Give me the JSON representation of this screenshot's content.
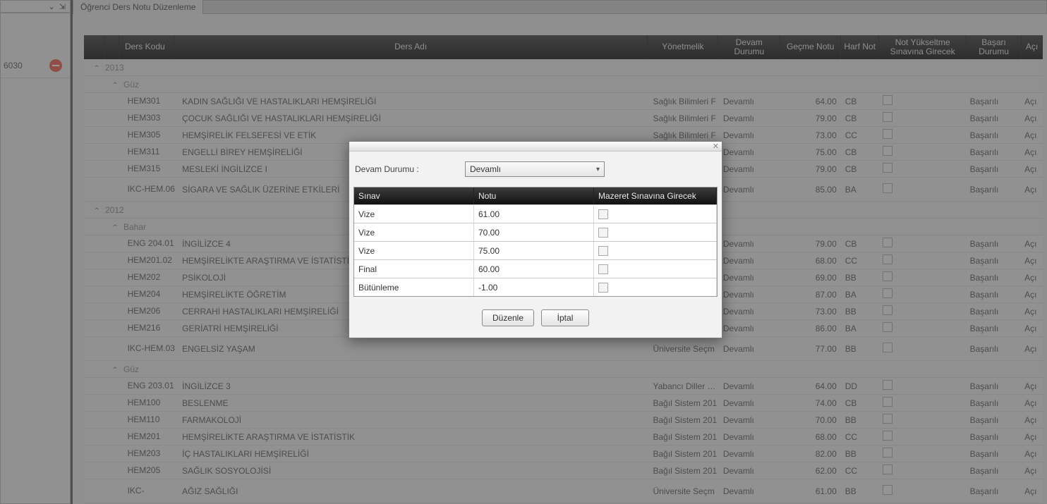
{
  "leftPanel": {
    "code": "6030"
  },
  "tab": {
    "title": "Öğrenci Ders Notu Düzenleme"
  },
  "gridHeader": {
    "dersKodu": "Ders Kodu",
    "dersAdi": "Ders Adı",
    "yonetmelik": "Yönetmelik",
    "devamDurumu": "Devam Durumu",
    "gecmeNotu": "Geçme Notu",
    "harfNot": "Harf Not",
    "notYukseltme": "Not Yükseltme Sınavına Girecek",
    "basariDurumu": "Başarı Durumu",
    "aciklama": "Açı"
  },
  "groups": [
    {
      "year": "2013",
      "terms": [
        {
          "name": "Güz",
          "rows": [
            {
              "code": "HEM301",
              "name": "KADIN SAĞLIĞI VE HASTALIKLARI HEMŞİRELİĞİ",
              "yon": "Sağlık Bilimleri F",
              "dev": "Devamlı",
              "gec": "64.00",
              "harf": "CB",
              "bas": "Başarılı",
              "ac": "Açı"
            },
            {
              "code": "HEM303",
              "name": "ÇOCUK SAĞLIĞI VE HASTALIKLARI HEMŞİRELİĞİ",
              "yon": "Sağlık Bilimleri F",
              "dev": "Devamlı",
              "gec": "79.00",
              "harf": "CB",
              "bas": "Başarılı",
              "ac": "Açı"
            },
            {
              "code": "HEM305",
              "name": "HEMŞİRELİK FELSEFESİ VE ETİK",
              "yon": "Sağlık Bilimleri F",
              "dev": "Devamlı",
              "gec": "73.00",
              "harf": "CC",
              "bas": "Başarılı",
              "ac": "Açı"
            },
            {
              "code": "HEM311",
              "name": "ENGELLİ BİREY HEMŞİRELİĞİ",
              "yon": "",
              "dev": "Devamlı",
              "gec": "75.00",
              "harf": "CB",
              "bas": "Başarılı",
              "ac": "Açı"
            },
            {
              "code": "HEM315",
              "name": "MESLEKİ İNGİLİZCE I",
              "yon": "",
              "dev": "Devamlı",
              "gec": "79.00",
              "harf": "CB",
              "bas": "Başarılı",
              "ac": "Açı"
            },
            {
              "code": "IKC-HEM.06",
              "name": "SİGARA VE SAĞLIK ÜZERİNE ETKİLERİ",
              "yon": "",
              "dev": "Devamlı",
              "gec": "85.00",
              "harf": "BA",
              "bas": "Başarılı",
              "ac": "Açı",
              "tall": true
            }
          ]
        }
      ]
    },
    {
      "year": "2012",
      "terms": [
        {
          "name": "Bahar",
          "rows": [
            {
              "code": "ENG 204.01",
              "name": "İNGİLİZCE 4",
              "yon": "",
              "dev": "Devamlı",
              "gec": "79.00",
              "harf": "CB",
              "bas": "Başarılı",
              "ac": "Açı"
            },
            {
              "code": "HEM201.02",
              "name": "HEMŞİRELİKTE ARAŞTIRMA VE İSTATİSTİK",
              "yon": "",
              "dev": "Devamlı",
              "gec": "68.00",
              "harf": "CC",
              "bas": "Başarılı",
              "ac": "Açı"
            },
            {
              "code": "HEM202",
              "name": "PSİKOLOJİ",
              "yon": "",
              "dev": "Devamlı",
              "gec": "69.00",
              "harf": "BB",
              "bas": "Başarılı",
              "ac": "Açı"
            },
            {
              "code": "HEM204",
              "name": "HEMŞİRELİKTE ÖĞRETİM",
              "yon": "",
              "dev": "Devamlı",
              "gec": "87.00",
              "harf": "BA",
              "bas": "Başarılı",
              "ac": "Açı"
            },
            {
              "code": "HEM206",
              "name": "CERRAHİ HASTALIKLARI HEMŞİRELİĞİ",
              "yon": "",
              "dev": "Devamlı",
              "gec": "73.00",
              "harf": "BB",
              "bas": "Başarılı",
              "ac": "Açı"
            },
            {
              "code": "HEM216",
              "name": "GERİATRİ HEMŞİRELİĞİ",
              "yon": "",
              "dev": "Devamlı",
              "gec": "86.00",
              "harf": "BA",
              "bas": "Başarılı",
              "ac": "Açı"
            },
            {
              "code": "IKC-HEM.03",
              "name": "ENGELSİZ YAŞAM",
              "yon": "Üniversite Seçm",
              "dev": "Devamlı",
              "gec": "77.00",
              "harf": "BB",
              "bas": "Başarılı",
              "ac": "Açı",
              "tall": true
            }
          ]
        },
        {
          "name": "Güz",
          "rows": [
            {
              "code": "ENG 203.01",
              "name": "İNGİLİZCE 3",
              "yon": "Yabancı Diller Yü",
              "dev": "Devamlı",
              "gec": "64.00",
              "harf": "DD",
              "bas": "Başarılı",
              "ac": "Açı"
            },
            {
              "code": "HEM100",
              "name": "BESLENME",
              "yon": "Bağıl Sistem 201",
              "dev": "Devamlı",
              "gec": "74.00",
              "harf": "CB",
              "bas": "Başarılı",
              "ac": "Açı"
            },
            {
              "code": "HEM110",
              "name": "FARMAKOLOJİ",
              "yon": "Bağıl Sistem 201",
              "dev": "Devamlı",
              "gec": "70.00",
              "harf": "BB",
              "bas": "Başarılı",
              "ac": "Açı"
            },
            {
              "code": "HEM201",
              "name": "HEMŞİRELİKTE ARAŞTIRMA VE İSTATİSTİK",
              "yon": "Bağıl Sistem 201",
              "dev": "Devamlı",
              "gec": "68.00",
              "harf": "CC",
              "bas": "Başarılı",
              "ac": "Açı"
            },
            {
              "code": "HEM203",
              "name": "İÇ HASTALIKLARI HEMŞİRELİĞİ",
              "yon": "Bağıl Sistem 201",
              "dev": "Devamlı",
              "gec": "82.00",
              "harf": "BB",
              "bas": "Başarılı",
              "ac": "Açı"
            },
            {
              "code": "HEM205",
              "name": "SAĞLIK SOSYOLOJİSİ",
              "yon": "Bağıl Sistem 201",
              "dev": "Devamlı",
              "gec": "62.00",
              "harf": "CC",
              "bas": "Başarılı",
              "ac": "Açı"
            },
            {
              "code": "IKC-",
              "name": "AĞIZ SAĞLIĞI",
              "yon": "Üniversite Seçm",
              "dev": "Devamlı",
              "gec": "61.00",
              "harf": "BB",
              "bas": "Başarılı",
              "ac": "Açı",
              "tall": true
            }
          ]
        }
      ]
    }
  ],
  "dialog": {
    "formLabel": "Devam Durumu :",
    "comboValue": "Devamlı",
    "headers": {
      "sinav": "Sınav",
      "notu": "Notu",
      "mazeret": "Mazeret Sınavına Girecek"
    },
    "rows": [
      {
        "sinav": "Vize",
        "notu": "61.00"
      },
      {
        "sinav": "Vize",
        "notu": "70.00"
      },
      {
        "sinav": "Vize",
        "notu": "75.00"
      },
      {
        "sinav": "Final",
        "notu": "60.00"
      },
      {
        "sinav": "Bütünleme",
        "notu": "-1.00"
      }
    ],
    "btnEdit": "Düzenle",
    "btnCancel": "İptal"
  }
}
